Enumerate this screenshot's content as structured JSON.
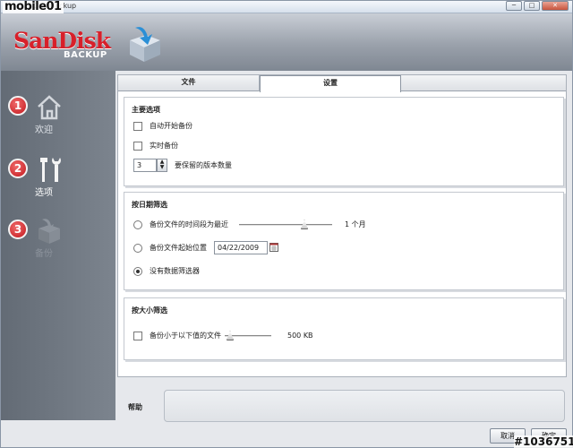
{
  "watermark": "mobile01",
  "window": {
    "title": "SanDisk Backup",
    "minimize": "─",
    "maximize": "□",
    "close": "✕"
  },
  "brand": {
    "name": "SanDisk",
    "product": "BACKUP"
  },
  "sidebar": {
    "items": [
      {
        "num": "1",
        "label": "欢迎",
        "icon": "home-icon"
      },
      {
        "num": "2",
        "label": "选项",
        "icon": "tools-icon"
      },
      {
        "num": "3",
        "label": "备份",
        "icon": "backup-box-icon"
      }
    ]
  },
  "tabs": [
    {
      "label": "文件"
    },
    {
      "label": "设置"
    }
  ],
  "settings": {
    "main": {
      "title": "主要选项",
      "auto_backup": "自动开始备份",
      "realtime_backup": "实时备份",
      "versions_value": "3",
      "versions_label": "要保留的版本数量"
    },
    "date_filter": {
      "title": "按日期筛选",
      "recent_label": "备份文件的时间段为最近",
      "recent_value_text": "1 个月",
      "recent_slider_fraction": 0.72,
      "start_label": "备份文件起始位置",
      "start_date": "04/22/2009",
      "no_filter_label": "没有数据筛选器",
      "selected": "no_filter"
    },
    "size_filter": {
      "title": "按大小筛选",
      "below_label": "备份小于以下值的文件",
      "size_text": "500 KB",
      "size_slider_fraction": 0.05
    }
  },
  "help": {
    "label": "帮助",
    "text": ""
  },
  "buttons": {
    "cancel": "取消",
    "ok": "确定"
  },
  "footer_id": "#1036751"
}
